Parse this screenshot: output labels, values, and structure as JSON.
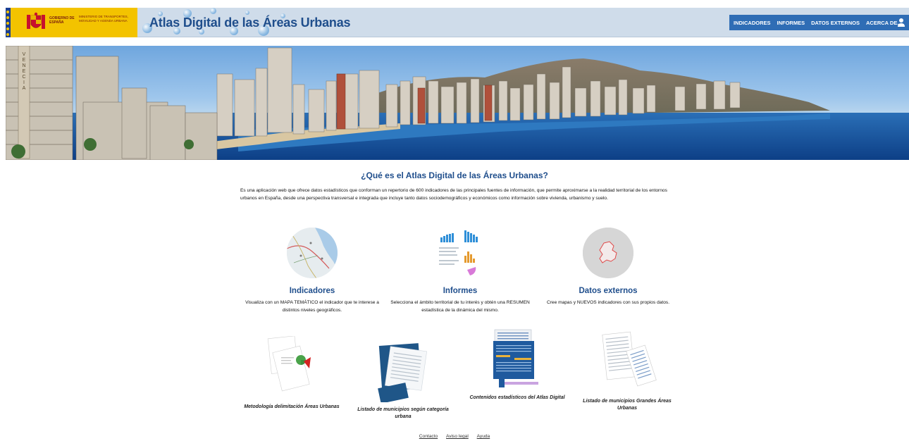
{
  "header": {
    "gov_label": "GOBIERNO DE ESPAÑA",
    "ministry_label": "MINISTERIO DE TRANSPORTES, MOVILIDAD Y AGENDA URBANA",
    "site_title": "Atlas Digital de las Áreas Urbanas",
    "nav": [
      "INDICADORES",
      "INFORMES",
      "DATOS EXTERNOS",
      "ACERCA DE..."
    ],
    "accent": "#2f6db5",
    "header_bg": "#cfdcea"
  },
  "banner": {
    "side_sign": "VENECIA"
  },
  "intro": {
    "title": "¿Qué es el Atlas Digital de las Áreas Urbanas?",
    "text": "Es una aplicación web que ofrece datos estadísticos que conforman un repertorio de 600 indicadores de las principales fuentes de información, que permite aproximarse a la realidad territorial de los entornos urbanos en España, desde una perspectiva transversal e integrada que incluye tanto datos sociodemográficos y económicos como información sobre vivienda, urbanismo y suelo."
  },
  "features": [
    {
      "title": "Indicadores",
      "desc": "Visualiza con un MAPA TEMÁTICO el indicador que te interese a distintos niveles geográficos."
    },
    {
      "title": "Informes",
      "desc": "Selecciona el ámbito territorial de tu interés y obtén una RESUMEN estadística de la dinámica del mismo."
    },
    {
      "title": "Datos externos",
      "desc": "Cree mapas y NUEVOS indicadores con sus propios datos."
    }
  ],
  "documents": [
    {
      "caption": "Metodología delimitación Áreas Urbanas"
    },
    {
      "caption": "Listado de municipios según categoría urbana"
    },
    {
      "caption": "Contenidos estadísticos del Atlas Digital"
    },
    {
      "caption": "Listado de municipios Grandes Áreas Urbanas"
    }
  ],
  "footer": {
    "links": [
      "Contacto",
      "Aviso legal",
      "Ayuda"
    ]
  }
}
